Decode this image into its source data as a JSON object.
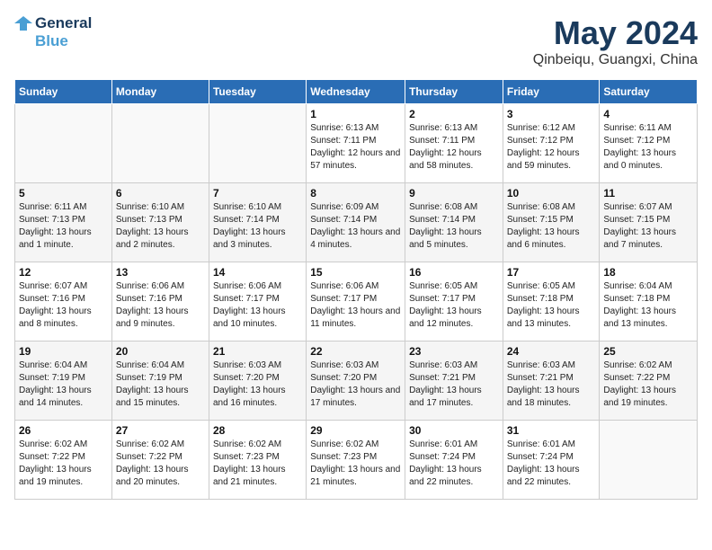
{
  "header": {
    "logo_line1": "General",
    "logo_line2": "Blue",
    "title": "May 2024",
    "subtitle": "Qinbeiqu, Guangxi, China"
  },
  "weekdays": [
    "Sunday",
    "Monday",
    "Tuesday",
    "Wednesday",
    "Thursday",
    "Friday",
    "Saturday"
  ],
  "weeks": [
    [
      {
        "num": "",
        "detail": ""
      },
      {
        "num": "",
        "detail": ""
      },
      {
        "num": "",
        "detail": ""
      },
      {
        "num": "1",
        "detail": "Sunrise: 6:13 AM\nSunset: 7:11 PM\nDaylight: 12 hours and 57 minutes."
      },
      {
        "num": "2",
        "detail": "Sunrise: 6:13 AM\nSunset: 7:11 PM\nDaylight: 12 hours and 58 minutes."
      },
      {
        "num": "3",
        "detail": "Sunrise: 6:12 AM\nSunset: 7:12 PM\nDaylight: 12 hours and 59 minutes."
      },
      {
        "num": "4",
        "detail": "Sunrise: 6:11 AM\nSunset: 7:12 PM\nDaylight: 13 hours and 0 minutes."
      }
    ],
    [
      {
        "num": "5",
        "detail": "Sunrise: 6:11 AM\nSunset: 7:13 PM\nDaylight: 13 hours and 1 minute."
      },
      {
        "num": "6",
        "detail": "Sunrise: 6:10 AM\nSunset: 7:13 PM\nDaylight: 13 hours and 2 minutes."
      },
      {
        "num": "7",
        "detail": "Sunrise: 6:10 AM\nSunset: 7:14 PM\nDaylight: 13 hours and 3 minutes."
      },
      {
        "num": "8",
        "detail": "Sunrise: 6:09 AM\nSunset: 7:14 PM\nDaylight: 13 hours and 4 minutes."
      },
      {
        "num": "9",
        "detail": "Sunrise: 6:08 AM\nSunset: 7:14 PM\nDaylight: 13 hours and 5 minutes."
      },
      {
        "num": "10",
        "detail": "Sunrise: 6:08 AM\nSunset: 7:15 PM\nDaylight: 13 hours and 6 minutes."
      },
      {
        "num": "11",
        "detail": "Sunrise: 6:07 AM\nSunset: 7:15 PM\nDaylight: 13 hours and 7 minutes."
      }
    ],
    [
      {
        "num": "12",
        "detail": "Sunrise: 6:07 AM\nSunset: 7:16 PM\nDaylight: 13 hours and 8 minutes."
      },
      {
        "num": "13",
        "detail": "Sunrise: 6:06 AM\nSunset: 7:16 PM\nDaylight: 13 hours and 9 minutes."
      },
      {
        "num": "14",
        "detail": "Sunrise: 6:06 AM\nSunset: 7:17 PM\nDaylight: 13 hours and 10 minutes."
      },
      {
        "num": "15",
        "detail": "Sunrise: 6:06 AM\nSunset: 7:17 PM\nDaylight: 13 hours and 11 minutes."
      },
      {
        "num": "16",
        "detail": "Sunrise: 6:05 AM\nSunset: 7:17 PM\nDaylight: 13 hours and 12 minutes."
      },
      {
        "num": "17",
        "detail": "Sunrise: 6:05 AM\nSunset: 7:18 PM\nDaylight: 13 hours and 13 minutes."
      },
      {
        "num": "18",
        "detail": "Sunrise: 6:04 AM\nSunset: 7:18 PM\nDaylight: 13 hours and 13 minutes."
      }
    ],
    [
      {
        "num": "19",
        "detail": "Sunrise: 6:04 AM\nSunset: 7:19 PM\nDaylight: 13 hours and 14 minutes."
      },
      {
        "num": "20",
        "detail": "Sunrise: 6:04 AM\nSunset: 7:19 PM\nDaylight: 13 hours and 15 minutes."
      },
      {
        "num": "21",
        "detail": "Sunrise: 6:03 AM\nSunset: 7:20 PM\nDaylight: 13 hours and 16 minutes."
      },
      {
        "num": "22",
        "detail": "Sunrise: 6:03 AM\nSunset: 7:20 PM\nDaylight: 13 hours and 17 minutes."
      },
      {
        "num": "23",
        "detail": "Sunrise: 6:03 AM\nSunset: 7:21 PM\nDaylight: 13 hours and 17 minutes."
      },
      {
        "num": "24",
        "detail": "Sunrise: 6:03 AM\nSunset: 7:21 PM\nDaylight: 13 hours and 18 minutes."
      },
      {
        "num": "25",
        "detail": "Sunrise: 6:02 AM\nSunset: 7:22 PM\nDaylight: 13 hours and 19 minutes."
      }
    ],
    [
      {
        "num": "26",
        "detail": "Sunrise: 6:02 AM\nSunset: 7:22 PM\nDaylight: 13 hours and 19 minutes."
      },
      {
        "num": "27",
        "detail": "Sunrise: 6:02 AM\nSunset: 7:22 PM\nDaylight: 13 hours and 20 minutes."
      },
      {
        "num": "28",
        "detail": "Sunrise: 6:02 AM\nSunset: 7:23 PM\nDaylight: 13 hours and 21 minutes."
      },
      {
        "num": "29",
        "detail": "Sunrise: 6:02 AM\nSunset: 7:23 PM\nDaylight: 13 hours and 21 minutes."
      },
      {
        "num": "30",
        "detail": "Sunrise: 6:01 AM\nSunset: 7:24 PM\nDaylight: 13 hours and 22 minutes."
      },
      {
        "num": "31",
        "detail": "Sunrise: 6:01 AM\nSunset: 7:24 PM\nDaylight: 13 hours and 22 minutes."
      },
      {
        "num": "",
        "detail": ""
      }
    ]
  ]
}
